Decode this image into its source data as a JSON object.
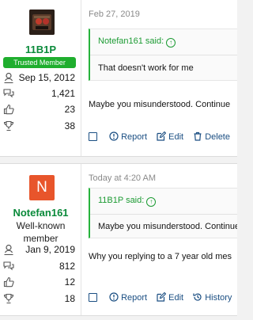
{
  "posts": [
    {
      "user": {
        "avatar_initial": "",
        "username": "11B1P",
        "badge": "Trusted Member",
        "rank": "",
        "joined": "Sep 15, 2012",
        "messages": "1,421",
        "reactions": "23",
        "points": "38"
      },
      "date": "Feb 27, 2019",
      "quote": {
        "author": "Notefan161 said:",
        "text": "That doesn't work for me"
      },
      "text": "Maybe you misunderstood. Continue",
      "actions": [
        "Report",
        "Edit",
        "Delete"
      ]
    },
    {
      "user": {
        "avatar_initial": "N",
        "username": "Notefan161",
        "badge": "",
        "rank": "Well-known member",
        "joined": "Jan 9, 2019",
        "messages": "812",
        "reactions": "12",
        "points": "18"
      },
      "date": "Today at 4:20 AM",
      "quote": {
        "author": "11B1P said:",
        "text": "Maybe you misunderstood. Continue"
      },
      "text": "Why you replying to a 7 year old mes",
      "actions": [
        "Report",
        "Edit",
        "History"
      ]
    }
  ],
  "icons": {
    "joined": "calendar-person-icon",
    "messages": "speech-bubbles-icon",
    "reactions": "thumbs-up-icon",
    "points": "trophy-icon",
    "report": "alert-circle-icon",
    "edit": "edit-icon",
    "delete": "trash-icon",
    "history": "history-icon",
    "quote_link": "arrow-up-circle-icon"
  },
  "colors": {
    "accent_green": "#1c9b33",
    "username_green": "#0a8a3a",
    "badge_green": "#1fae2e",
    "link_blue": "#1a4e82",
    "avatar_orange": "#e8552b"
  }
}
